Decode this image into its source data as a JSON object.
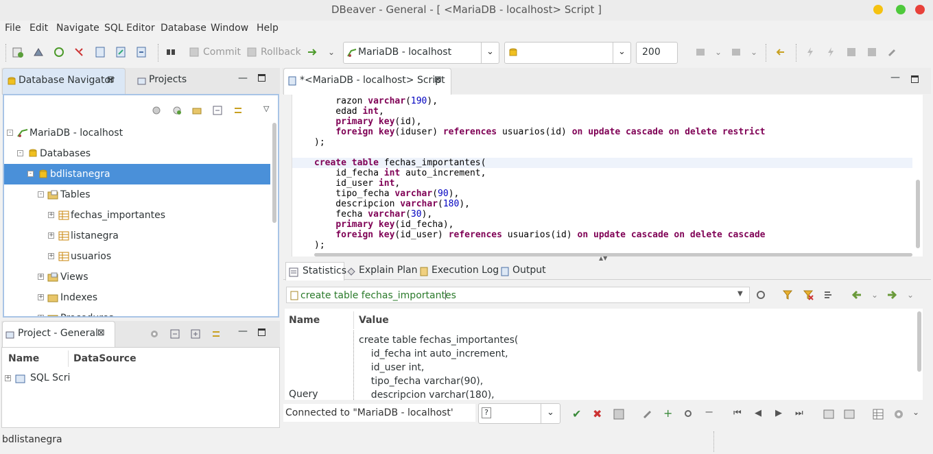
{
  "window": {
    "title": "DBeaver - General - [ <MariaDB - localhost> Script ]"
  },
  "menu": [
    "File",
    "Edit",
    "Navigate",
    "SQL Editor",
    "Database",
    "Window",
    "Help"
  ],
  "toolbar": {
    "commit_label": "Commit",
    "rollback_label": "Rollback",
    "connection": "MariaDB - localhost",
    "schema": "",
    "limit": "200"
  },
  "navigator": {
    "tab_label": "Database Navigator",
    "projects_tab": "Projects",
    "tree": {
      "connection": "MariaDB - localhost",
      "databases": "Databases",
      "database": "bdlistanegra",
      "tables": "Tables",
      "table_items": [
        "fechas_importantes",
        "listanegra",
        "usuarios"
      ],
      "views": "Views",
      "indexes": "Indexes",
      "partial": "Procedures"
    }
  },
  "project": {
    "tab_label": "Project - General",
    "col_name": "Name",
    "col_datasource": "DataSource",
    "item": "SQL Scri"
  },
  "editor": {
    "tab_label": "*<MariaDB - localhost> Script"
  },
  "results": {
    "tabs": [
      "Statistics",
      "Explain Plan",
      "Execution Log",
      "Output"
    ],
    "filter_text": "create table fechas_importantes",
    "col_name": "Name",
    "col_value": "Value",
    "row_name": "Query",
    "query_lines": [
      "create table fechas_importantes(",
      "    id_fecha int auto_increment,",
      "    id_user int,",
      "    tipo_fecha varchar(90),",
      "    descripcion varchar(180),"
    ],
    "status": "Connected to \"MariaDB - localhost'"
  },
  "statusbar": {
    "text": "bdlistanegra"
  },
  "colors": {
    "selection": "#4a90d9",
    "keyword": "#7f0055",
    "number": "#0000c0"
  }
}
